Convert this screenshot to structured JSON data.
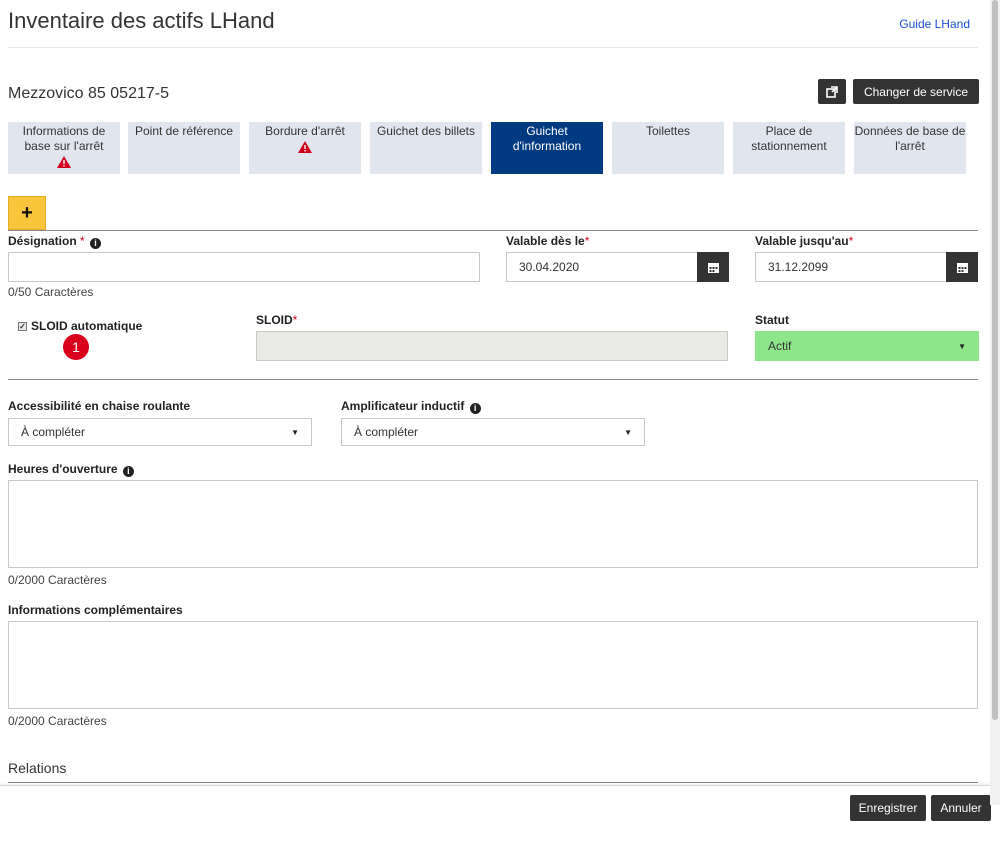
{
  "header": {
    "title": "Inventaire des actifs LHand",
    "guide_link": "Guide LHand"
  },
  "station": {
    "name": "Mezzovico 85 05217-5",
    "change_service_label": "Changer de service"
  },
  "tabs": [
    {
      "label": "Informations de base sur l'arrêt",
      "warning": true
    },
    {
      "label": "Point de référence",
      "warning": false
    },
    {
      "label": "Bordure d'arrêt",
      "warning": true
    },
    {
      "label": "Guichet des billets",
      "warning": false
    },
    {
      "label": "Guichet d'information",
      "warning": false,
      "active": true
    },
    {
      "label": "Toilettes",
      "warning": false
    },
    {
      "label": "Place de stationnement",
      "warning": false
    },
    {
      "label": "Données de base de l'arrêt",
      "warning": false
    }
  ],
  "add_button": "+",
  "form": {
    "designation_label": "Désignation",
    "designation_value": "",
    "designation_helper": "0/50 Caractères",
    "valid_from_label": "Valable dès le",
    "valid_from_value": "30.04.2020",
    "valid_to_label": "Valable jusqu'au",
    "valid_to_value": "31.12.2099",
    "sloid_auto_label": "SLOID automatique",
    "sloid_auto_checked": true,
    "marker_number": "1",
    "sloid_label": "SLOID",
    "sloid_value": "",
    "status_label": "Statut",
    "status_value": "Actif",
    "wheelchair_label": "Accessibilité en chaise roulante",
    "wheelchair_value": "À compléter",
    "induction_label": "Amplificateur inductif",
    "induction_value": "À compléter",
    "hours_label": "Heures d'ouverture",
    "hours_helper": "0/2000 Caractères",
    "additional_info_label": "Informations complémentaires",
    "additional_info_helper": "0/2000 Caractères",
    "required_mark": "*"
  },
  "relations": {
    "title": "Relations"
  },
  "footer": {
    "save_label": "Enregistrer",
    "cancel_label": "Annuler"
  },
  "colors": {
    "active_tab": "#003a80",
    "tab_bg": "#e1e5ed",
    "add_button": "#f9c53b",
    "status_active": "#8ee68b",
    "dark_button": "#333333",
    "marker": "#d8001c",
    "link": "#1a4fd6"
  },
  "icons": {
    "external": "external-link-icon",
    "calendar": "calendar-icon",
    "info": "info-circle-icon",
    "warning": "warning-triangle-icon",
    "dropdown": "caret-down-icon"
  }
}
